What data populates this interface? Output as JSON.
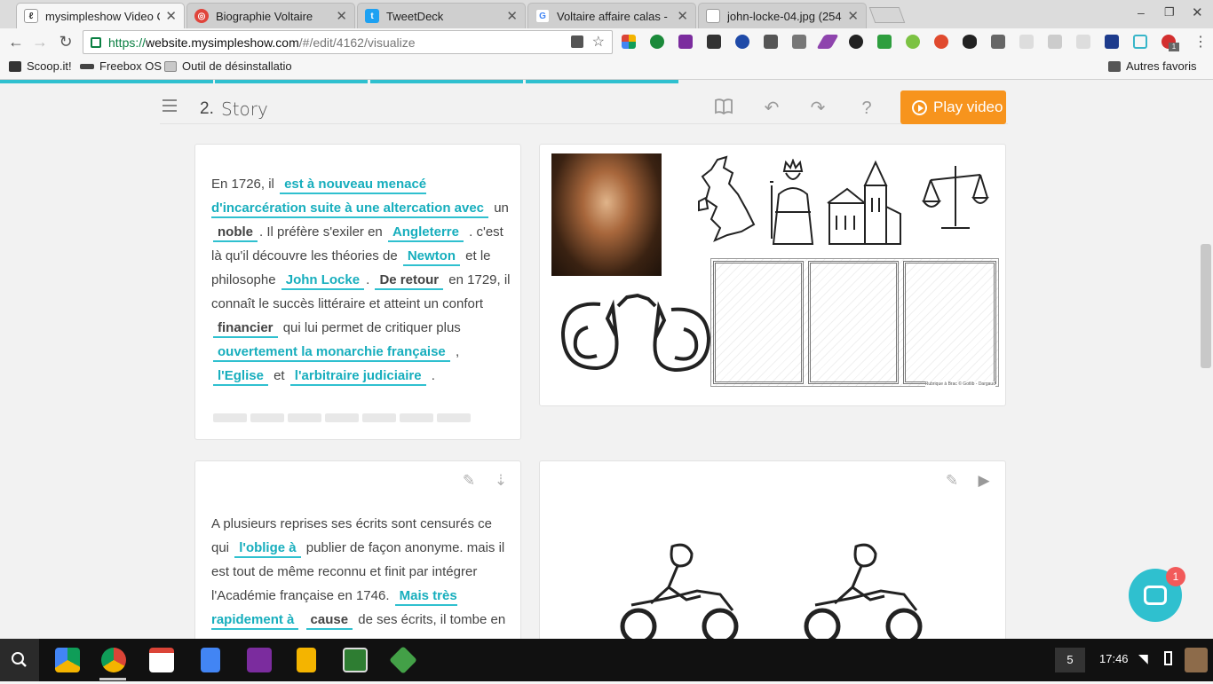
{
  "browser": {
    "tabs": [
      {
        "label": "mysimpleshow Video Cr",
        "icon": "mysimpleshow-icon"
      },
      {
        "label": "Biographie Voltaire",
        "icon": "biography-icon"
      },
      {
        "label": "TweetDeck",
        "icon": "twitter-icon"
      },
      {
        "label": "Voltaire affaire calas - Re",
        "icon": "google-icon"
      },
      {
        "label": "john-locke-04.jpg (254×2",
        "icon": "file-icon"
      }
    ],
    "url": "https://website.mysimpleshow.com/#/edit/4162/visualize",
    "url_scheme": "https://",
    "url_host": "website.mysimpleshow.com",
    "url_path": "/#/edit/4162/visualize",
    "bookmarks": [
      "Scoop.it!",
      "Freebox OS",
      "Outil de désinstallatio"
    ],
    "other_bookmarks": "Autres favoris",
    "abp_badge": "1"
  },
  "app": {
    "step_number": "2.",
    "step_title": "Story",
    "play_button": "Play video",
    "chat_badge": "1",
    "colors": {
      "accent": "#2fc0cf",
      "play": "#f7941d"
    }
  },
  "card1": {
    "t1": "En 1726, il",
    "k1": "est à nouveau menacé d'incarcération suite à une altercation avec",
    "t2": "un",
    "k2": "noble",
    "t3": ". Il préfère s'exiler en",
    "k3": "Angleterre",
    "t4": ". c'est là qu'il découvre les théories de",
    "k4": "Newton",
    "t5": "et le philosophe",
    "k5": "John Locke",
    "t6": ".",
    "k6": "De retour",
    "t7": "en 1729, il connaît le succès littéraire et atteint un confort",
    "k7": "financier",
    "t8": "qui lui permet de critiquer plus",
    "k8": "ouvertement la monarchie française",
    "t9": ",",
    "k9": "l'Eglise",
    "t10": "et",
    "k10": "l'arbitraire judiciaire",
    "t11": "."
  },
  "card2": {
    "t1": "A plusieurs reprises ses écrits sont censurés ce qui",
    "k1": "l'oblige à",
    "t2": "publier de façon anonyme. mais il est tout de même reconnu et finit par intégrer l'Académie française en 1746.",
    "k2": "Mais très rapidement à",
    "k3": "cause",
    "t3": "de ses écrits, il tombe en"
  },
  "image_credit": "Rubrique à Brac © Gotlib - Dargaud",
  "taskbar": {
    "badge": "5",
    "time": "17:46"
  }
}
